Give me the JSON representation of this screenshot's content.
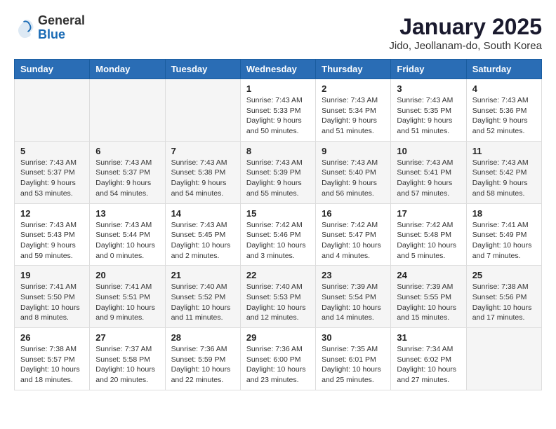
{
  "header": {
    "logo_general": "General",
    "logo_blue": "Blue",
    "title": "January 2025",
    "subtitle": "Jido, Jeollanam-do, South Korea"
  },
  "weekdays": [
    "Sunday",
    "Monday",
    "Tuesday",
    "Wednesday",
    "Thursday",
    "Friday",
    "Saturday"
  ],
  "weeks": [
    [
      {
        "day": "",
        "info": ""
      },
      {
        "day": "",
        "info": ""
      },
      {
        "day": "",
        "info": ""
      },
      {
        "day": "1",
        "info": "Sunrise: 7:43 AM\nSunset: 5:33 PM\nDaylight: 9 hours\nand 50 minutes."
      },
      {
        "day": "2",
        "info": "Sunrise: 7:43 AM\nSunset: 5:34 PM\nDaylight: 9 hours\nand 51 minutes."
      },
      {
        "day": "3",
        "info": "Sunrise: 7:43 AM\nSunset: 5:35 PM\nDaylight: 9 hours\nand 51 minutes."
      },
      {
        "day": "4",
        "info": "Sunrise: 7:43 AM\nSunset: 5:36 PM\nDaylight: 9 hours\nand 52 minutes."
      }
    ],
    [
      {
        "day": "5",
        "info": "Sunrise: 7:43 AM\nSunset: 5:37 PM\nDaylight: 9 hours\nand 53 minutes."
      },
      {
        "day": "6",
        "info": "Sunrise: 7:43 AM\nSunset: 5:37 PM\nDaylight: 9 hours\nand 54 minutes."
      },
      {
        "day": "7",
        "info": "Sunrise: 7:43 AM\nSunset: 5:38 PM\nDaylight: 9 hours\nand 54 minutes."
      },
      {
        "day": "8",
        "info": "Sunrise: 7:43 AM\nSunset: 5:39 PM\nDaylight: 9 hours\nand 55 minutes."
      },
      {
        "day": "9",
        "info": "Sunrise: 7:43 AM\nSunset: 5:40 PM\nDaylight: 9 hours\nand 56 minutes."
      },
      {
        "day": "10",
        "info": "Sunrise: 7:43 AM\nSunset: 5:41 PM\nDaylight: 9 hours\nand 57 minutes."
      },
      {
        "day": "11",
        "info": "Sunrise: 7:43 AM\nSunset: 5:42 PM\nDaylight: 9 hours\nand 58 minutes."
      }
    ],
    [
      {
        "day": "12",
        "info": "Sunrise: 7:43 AM\nSunset: 5:43 PM\nDaylight: 9 hours\nand 59 minutes."
      },
      {
        "day": "13",
        "info": "Sunrise: 7:43 AM\nSunset: 5:44 PM\nDaylight: 10 hours\nand 0 minutes."
      },
      {
        "day": "14",
        "info": "Sunrise: 7:43 AM\nSunset: 5:45 PM\nDaylight: 10 hours\nand 2 minutes."
      },
      {
        "day": "15",
        "info": "Sunrise: 7:42 AM\nSunset: 5:46 PM\nDaylight: 10 hours\nand 3 minutes."
      },
      {
        "day": "16",
        "info": "Sunrise: 7:42 AM\nSunset: 5:47 PM\nDaylight: 10 hours\nand 4 minutes."
      },
      {
        "day": "17",
        "info": "Sunrise: 7:42 AM\nSunset: 5:48 PM\nDaylight: 10 hours\nand 5 minutes."
      },
      {
        "day": "18",
        "info": "Sunrise: 7:41 AM\nSunset: 5:49 PM\nDaylight: 10 hours\nand 7 minutes."
      }
    ],
    [
      {
        "day": "19",
        "info": "Sunrise: 7:41 AM\nSunset: 5:50 PM\nDaylight: 10 hours\nand 8 minutes."
      },
      {
        "day": "20",
        "info": "Sunrise: 7:41 AM\nSunset: 5:51 PM\nDaylight: 10 hours\nand 9 minutes."
      },
      {
        "day": "21",
        "info": "Sunrise: 7:40 AM\nSunset: 5:52 PM\nDaylight: 10 hours\nand 11 minutes."
      },
      {
        "day": "22",
        "info": "Sunrise: 7:40 AM\nSunset: 5:53 PM\nDaylight: 10 hours\nand 12 minutes."
      },
      {
        "day": "23",
        "info": "Sunrise: 7:39 AM\nSunset: 5:54 PM\nDaylight: 10 hours\nand 14 minutes."
      },
      {
        "day": "24",
        "info": "Sunrise: 7:39 AM\nSunset: 5:55 PM\nDaylight: 10 hours\nand 15 minutes."
      },
      {
        "day": "25",
        "info": "Sunrise: 7:38 AM\nSunset: 5:56 PM\nDaylight: 10 hours\nand 17 minutes."
      }
    ],
    [
      {
        "day": "26",
        "info": "Sunrise: 7:38 AM\nSunset: 5:57 PM\nDaylight: 10 hours\nand 18 minutes."
      },
      {
        "day": "27",
        "info": "Sunrise: 7:37 AM\nSunset: 5:58 PM\nDaylight: 10 hours\nand 20 minutes."
      },
      {
        "day": "28",
        "info": "Sunrise: 7:36 AM\nSunset: 5:59 PM\nDaylight: 10 hours\nand 22 minutes."
      },
      {
        "day": "29",
        "info": "Sunrise: 7:36 AM\nSunset: 6:00 PM\nDaylight: 10 hours\nand 23 minutes."
      },
      {
        "day": "30",
        "info": "Sunrise: 7:35 AM\nSunset: 6:01 PM\nDaylight: 10 hours\nand 25 minutes."
      },
      {
        "day": "31",
        "info": "Sunrise: 7:34 AM\nSunset: 6:02 PM\nDaylight: 10 hours\nand 27 minutes."
      },
      {
        "day": "",
        "info": ""
      }
    ]
  ]
}
